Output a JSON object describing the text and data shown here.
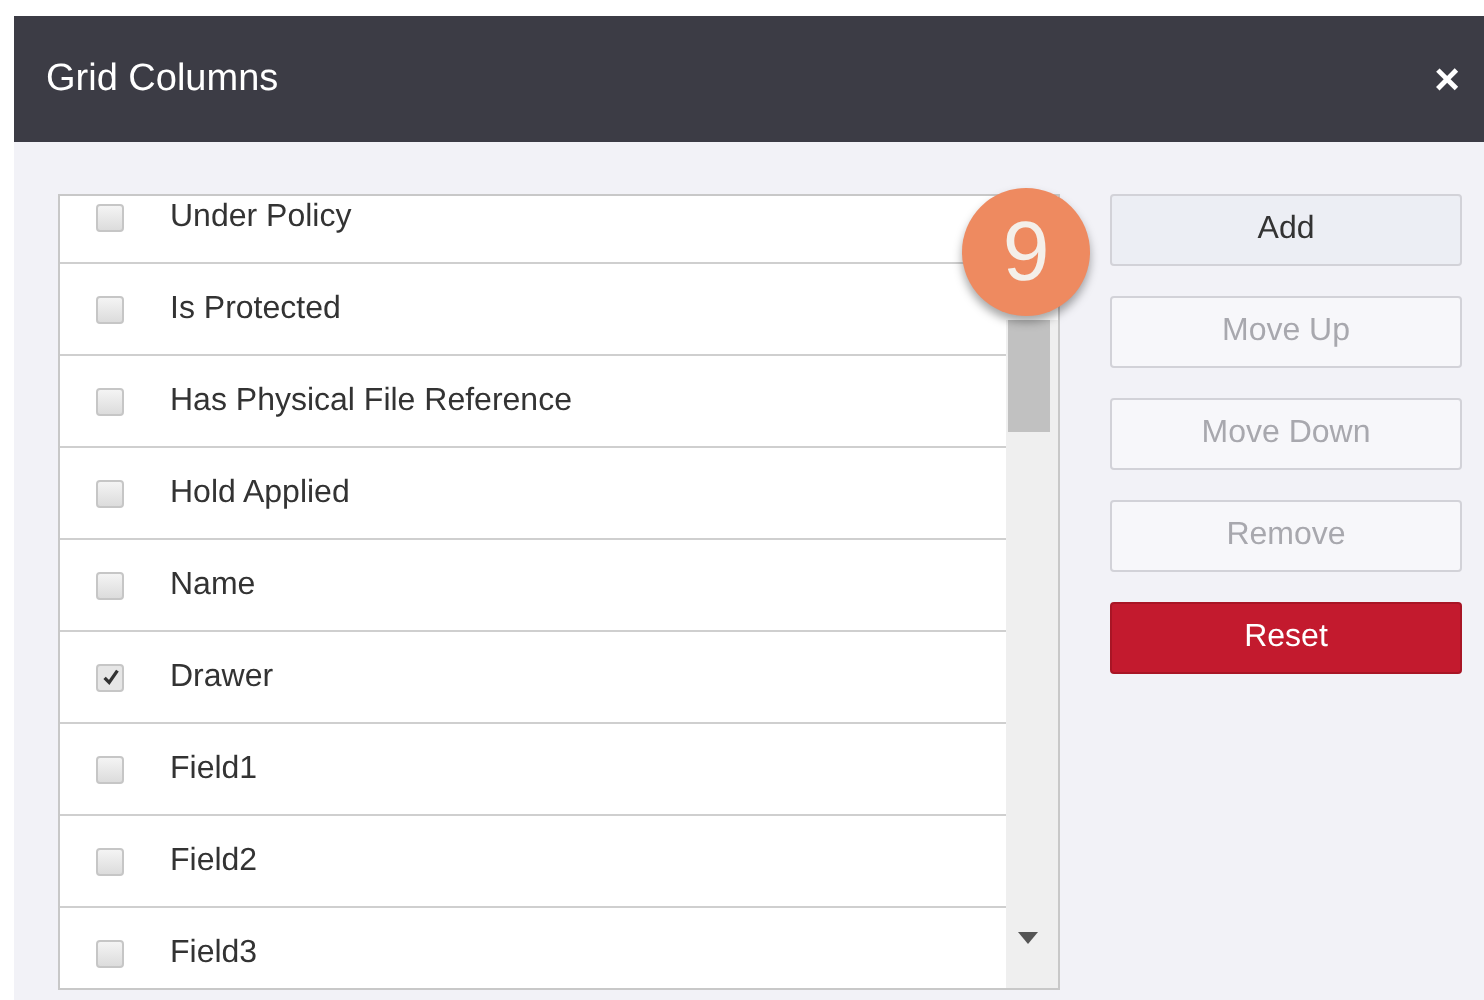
{
  "window": {
    "title": "Grid Columns",
    "close": "×"
  },
  "callout": "9",
  "columns": [
    {
      "label": "Under Policy",
      "checked": false
    },
    {
      "label": "Is Protected",
      "checked": false
    },
    {
      "label": "Has Physical File Reference",
      "checked": false
    },
    {
      "label": "Hold Applied",
      "checked": false
    },
    {
      "label": "Name",
      "checked": false
    },
    {
      "label": "Drawer",
      "checked": true
    },
    {
      "label": "Field1",
      "checked": false
    },
    {
      "label": "Field2",
      "checked": false
    },
    {
      "label": "Field3",
      "checked": false
    }
  ],
  "buttons": [
    {
      "label": "Add",
      "kind": "default",
      "disabled": false
    },
    {
      "label": "Move Up",
      "kind": "default",
      "disabled": true
    },
    {
      "label": "Move Down",
      "kind": "default",
      "disabled": true
    },
    {
      "label": "Remove",
      "kind": "default",
      "disabled": true
    },
    {
      "label": "Reset",
      "kind": "danger",
      "disabled": false
    }
  ]
}
